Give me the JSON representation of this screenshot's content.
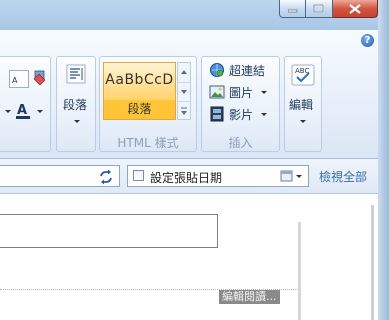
{
  "window": {
    "buttons": [
      "minimize",
      "maximize",
      "close"
    ]
  },
  "ribbon": {
    "help_glyph": "?",
    "paragraph_button": "段落",
    "style_gallery": {
      "sample_text": "AaBbCcD",
      "selected_style": "段落"
    },
    "html_style_group_label": "HTML 樣式",
    "insert_group": {
      "label": "插入",
      "hyperlink": "超連結",
      "picture": "圖片",
      "video": "影片"
    },
    "edit_button": "編輯",
    "edit_icon_text": "ABC"
  },
  "toolbar": {
    "set_paste_date_label": "設定張貼日期",
    "view_all_link": "檢視全部"
  },
  "content": {
    "edit_html_label": "編輯閱讀..."
  },
  "colors": {
    "accent_gallery": "#ffc437",
    "link": "#3a6cb0",
    "close_button": "#d3553f"
  }
}
